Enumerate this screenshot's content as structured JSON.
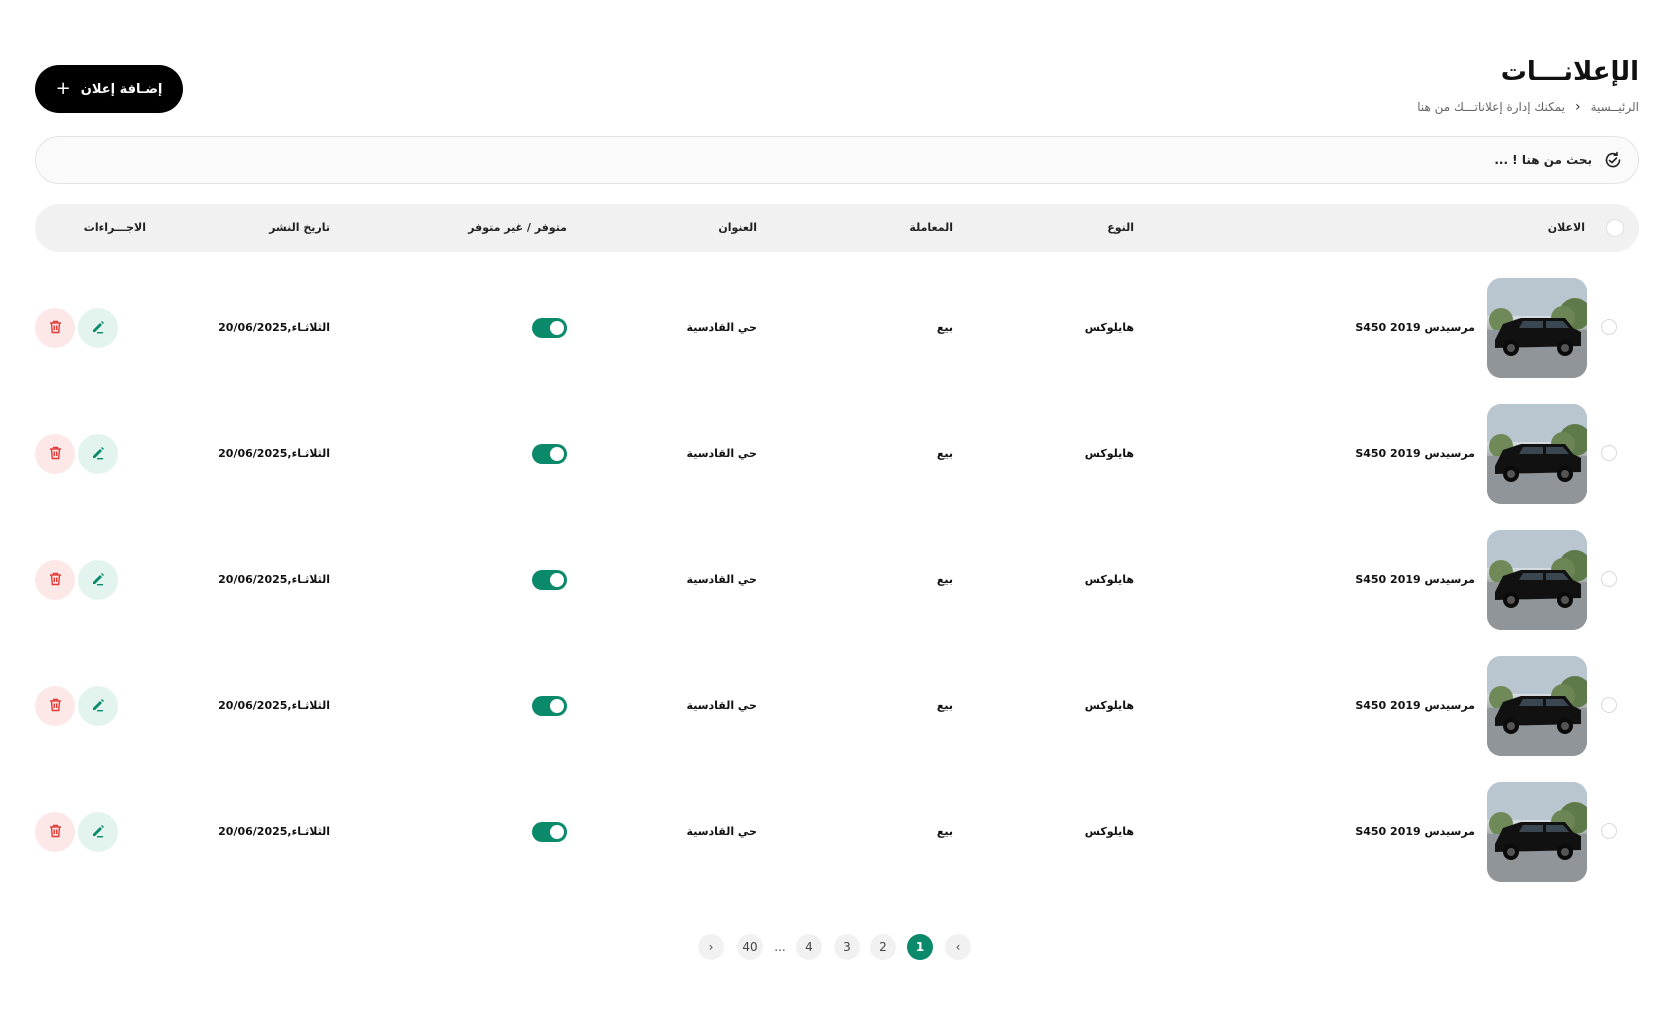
{
  "page": {
    "title": "الإعلانـــات",
    "breadcrumb": {
      "home": "الرئيــسية",
      "current": "يمكنك إدارة إعلاناتـــك من هنا"
    },
    "add_button": "إضـافة إعلان"
  },
  "search": {
    "placeholder": "بحث من هنا ! ..."
  },
  "table": {
    "columns": {
      "ad": "الاعلان",
      "type": "النوع",
      "deal": "المعاملة",
      "address": "العنوان",
      "availability": "متوفر / غير متوفر",
      "date": "تاريخ النشر",
      "actions": "الاجـــراءات"
    },
    "rows": [
      {
        "title": "مرسيدس 2019 S450",
        "type": "هايلوكس",
        "deal": "بيع",
        "address": "حي القادسية",
        "available": true,
        "date": "الثلاثـاء,20/06/2025"
      },
      {
        "title": "مرسيدس 2019 S450",
        "type": "هايلوكس",
        "deal": "بيع",
        "address": "حي القادسية",
        "available": true,
        "date": "الثلاثـاء,20/06/2025"
      },
      {
        "title": "مرسيدس 2019 S450",
        "type": "هايلوكس",
        "deal": "بيع",
        "address": "حي القادسية",
        "available": true,
        "date": "الثلاثـاء,20/06/2025"
      },
      {
        "title": "مرسيدس 2019 S450",
        "type": "هايلوكس",
        "deal": "بيع",
        "address": "حي القادسية",
        "available": true,
        "date": "الثلاثـاء,20/06/2025"
      },
      {
        "title": "مرسيدس 2019 S450",
        "type": "هايلوكس",
        "deal": "بيع",
        "address": "حي القادسية",
        "available": true,
        "date": "الثلاثـاء,20/06/2025"
      }
    ]
  },
  "pagination": {
    "prev": "‹",
    "next": "›",
    "pages": [
      "1",
      "2",
      "3",
      "4",
      "...",
      "40"
    ],
    "current": "1"
  },
  "colors": {
    "accent": "#0a8a6a",
    "delete": "#e53935",
    "edit_bg": "#e3f4ee",
    "delete_bg": "#fde8e8"
  },
  "icons": {
    "add": "plus-icon",
    "search": "search-refresh-icon",
    "edit": "pencil-icon",
    "delete": "trash-icon"
  }
}
